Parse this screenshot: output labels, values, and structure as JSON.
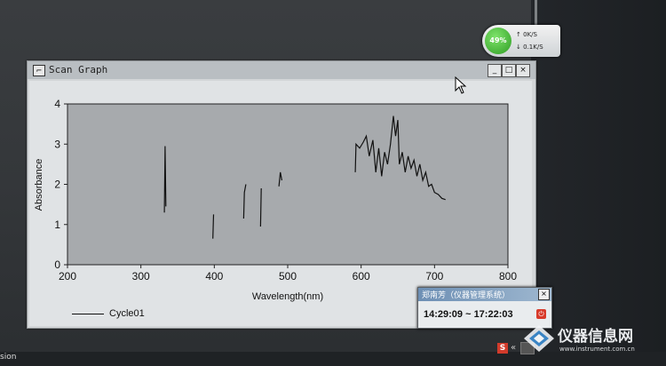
{
  "window": {
    "title": "Scan Graph",
    "minimize_glyph": "_",
    "maximize_glyph": "□",
    "close_glyph": "×"
  },
  "network_monitor": {
    "percent": "49%",
    "up_arrow": "↑",
    "down_arrow": "↓",
    "upload": "0K/S",
    "download": "0.1K/S"
  },
  "legend": {
    "series_name": "Cycle01"
  },
  "timer_popup": {
    "title": "郑南芳（仪器管理系统）",
    "time_range": "14:29:09 ~ 17:22:03",
    "close_glyph": "×"
  },
  "taskbar": {
    "left_text": "sion",
    "tray_s": "S",
    "tray_arrows": "«"
  },
  "watermark": {
    "text": "仪器信息网",
    "url": "www.instrument.com.cn"
  },
  "chart_data": {
    "type": "line",
    "xlabel": "Wavelength(nm)",
    "ylabel": "Absorbance",
    "xlim": [
      200,
      800
    ],
    "ylim": [
      0,
      4
    ],
    "xticks": [
      200,
      300,
      400,
      500,
      600,
      700,
      800
    ],
    "yticks": [
      0,
      1,
      2,
      3,
      4
    ],
    "grid": false,
    "series": [
      {
        "name": "Cycle01",
        "segments": [
          [
            [
              332,
              1.3
            ],
            [
              333,
              2.95
            ],
            [
              334,
              1.45
            ]
          ],
          [
            [
              398,
              0.65
            ],
            [
              399,
              1.25
            ]
          ],
          [
            [
              440,
              1.15
            ],
            [
              441,
              1.8
            ],
            [
              443,
              2.0
            ]
          ],
          [
            [
              463,
              0.95
            ],
            [
              464,
              1.9
            ]
          ],
          [
            [
              488,
              1.95
            ],
            [
              490,
              2.3
            ],
            [
              492,
              2.1
            ]
          ],
          [
            [
              592,
              2.3
            ],
            [
              593,
              3.0
            ],
            [
              598,
              2.9
            ],
            [
              603,
              3.05
            ],
            [
              607,
              3.2
            ],
            [
              611,
              2.7
            ],
            [
              616,
              3.1
            ],
            [
              620,
              2.3
            ],
            [
              624,
              2.9
            ],
            [
              628,
              2.2
            ],
            [
              632,
              2.8
            ],
            [
              636,
              2.5
            ],
            [
              640,
              3.0
            ],
            [
              644,
              3.7
            ],
            [
              647,
              3.2
            ],
            [
              650,
              3.6
            ],
            [
              652,
              2.5
            ],
            [
              656,
              2.8
            ],
            [
              660,
              2.3
            ],
            [
              664,
              2.7
            ],
            [
              668,
              2.4
            ],
            [
              672,
              2.6
            ],
            [
              676,
              2.2
            ],
            [
              680,
              2.5
            ],
            [
              684,
              2.1
            ],
            [
              688,
              2.3
            ],
            [
              692,
              1.95
            ],
            [
              696,
              2.0
            ],
            [
              700,
              1.8
            ],
            [
              705,
              1.75
            ],
            [
              710,
              1.65
            ],
            [
              715,
              1.62
            ]
          ]
        ]
      }
    ]
  }
}
